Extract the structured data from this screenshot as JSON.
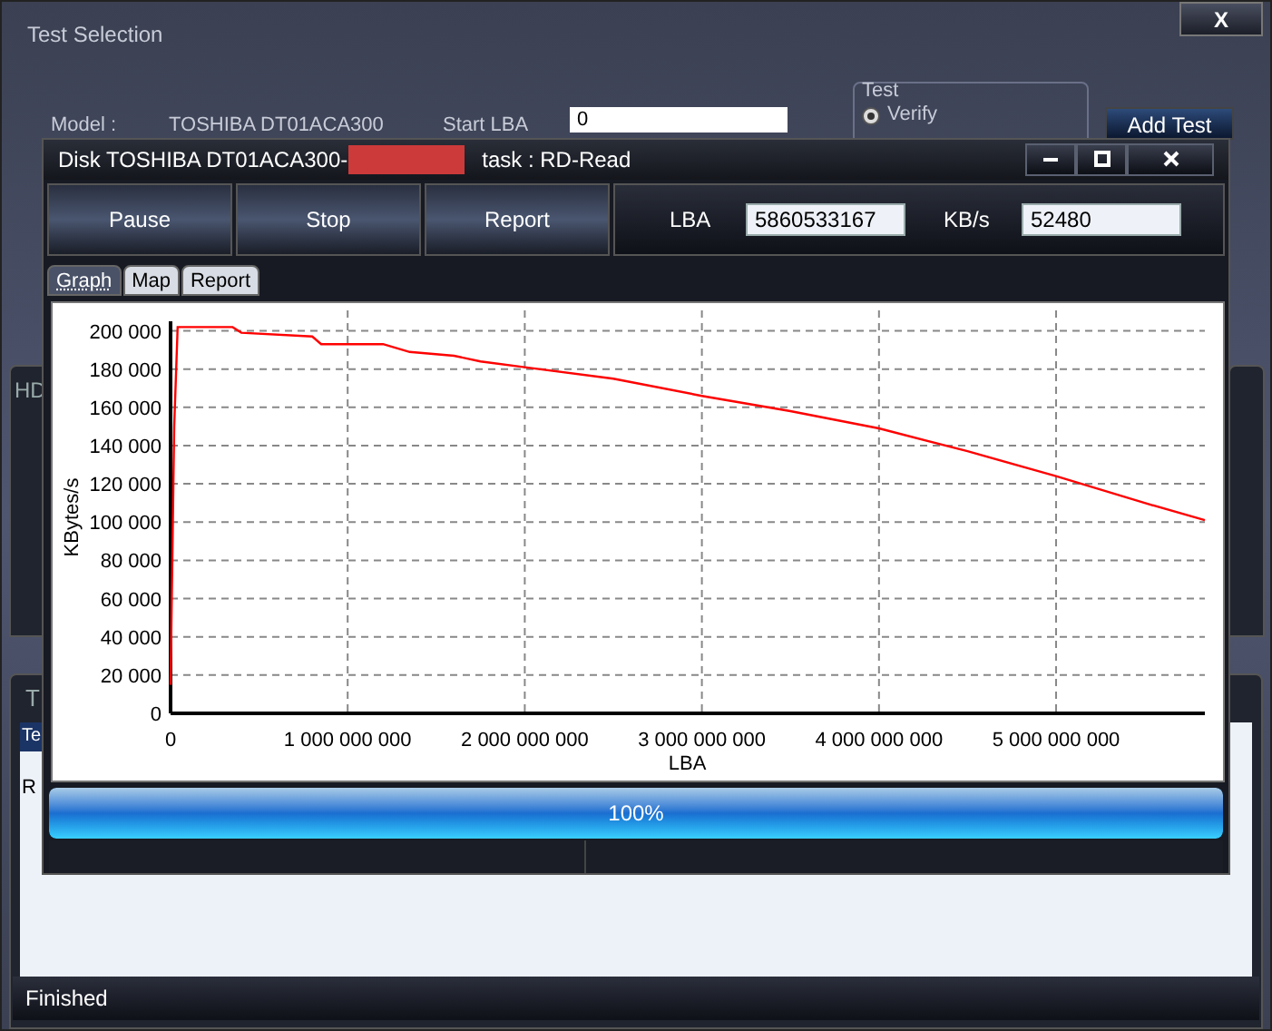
{
  "main_window": {
    "title": "Test Selection",
    "close": "X",
    "model_label": "Model :",
    "model_value": "TOSHIBA DT01ACA300",
    "start_lba_label": "Start LBA",
    "start_lba_value": "0",
    "test_group": {
      "title": "Test",
      "options": [
        {
          "label": "Verify",
          "selected": true
        }
      ]
    },
    "add_test": "Add Test",
    "hd_panel_title": "HD",
    "tasks_panel_title": "T",
    "table_header": "Te",
    "table_row": "R",
    "status": "Finished"
  },
  "dialog": {
    "title_prefix": "Disk TOSHIBA DT01ACA300-",
    "title_task": "task : RD-Read",
    "redacted": true,
    "window_buttons": [
      {
        "kind": "minimize"
      },
      {
        "kind": "maximize"
      },
      {
        "kind": "close"
      }
    ],
    "toolbar": [
      "Pause",
      "Stop",
      "Report"
    ],
    "lba_label": "LBA",
    "lba_value": "5860533167",
    "speed_label": "KB/s",
    "speed_value": "52480",
    "tabs": [
      {
        "label": "Graph",
        "selected": true
      },
      {
        "label": "Map",
        "selected": false
      },
      {
        "label": "Report",
        "selected": false
      }
    ],
    "chart_data": {
      "type": "line",
      "xlabel": "LBA",
      "ylabel": "KBytes/s",
      "grid": true,
      "x": [
        0,
        20000000,
        40000000,
        350000000,
        400000000,
        800000000,
        850000000,
        1200000000,
        1350000000,
        1600000000,
        1750000000,
        2000000000,
        2500000000,
        3000000000,
        3500000000,
        4000000000,
        4500000000,
        5000000000,
        5500000000,
        5840000000
      ],
      "series": [
        {
          "color": "#ff0000",
          "values": [
            15000,
            150000,
            202000,
            202000,
            199000,
            197000,
            193000,
            193000,
            189000,
            187000,
            184000,
            181000,
            175000,
            166000,
            158000,
            149000,
            137000,
            124000,
            110000,
            101000
          ]
        }
      ],
      "xlim": [
        0,
        5840000000
      ],
      "ylim": [
        0,
        205000
      ],
      "xticks": [
        {
          "value": 0,
          "label": "0"
        },
        {
          "value": 1000000000,
          "label": "1 000 000 000"
        },
        {
          "value": 2000000000,
          "label": "2 000 000 000"
        },
        {
          "value": 3000000000,
          "label": "3 000 000 000"
        },
        {
          "value": 4000000000,
          "label": "4 000 000 000"
        },
        {
          "value": 5000000000,
          "label": "5 000 000 000"
        }
      ],
      "yticks": [
        {
          "value": 0,
          "label": "0"
        },
        {
          "value": 20000,
          "label": "20 000"
        },
        {
          "value": 40000,
          "label": "40 000"
        },
        {
          "value": 60000,
          "label": "60 000"
        },
        {
          "value": 80000,
          "label": "80 000"
        },
        {
          "value": 100000,
          "label": "100 000"
        },
        {
          "value": 120000,
          "label": "120 000"
        },
        {
          "value": 140000,
          "label": "140 000"
        },
        {
          "value": 160000,
          "label": "160 000"
        },
        {
          "value": 180000,
          "label": "180 000"
        },
        {
          "value": 200000,
          "label": "200 000"
        }
      ]
    },
    "progress": {
      "level": 1,
      "reading": "100%"
    }
  }
}
